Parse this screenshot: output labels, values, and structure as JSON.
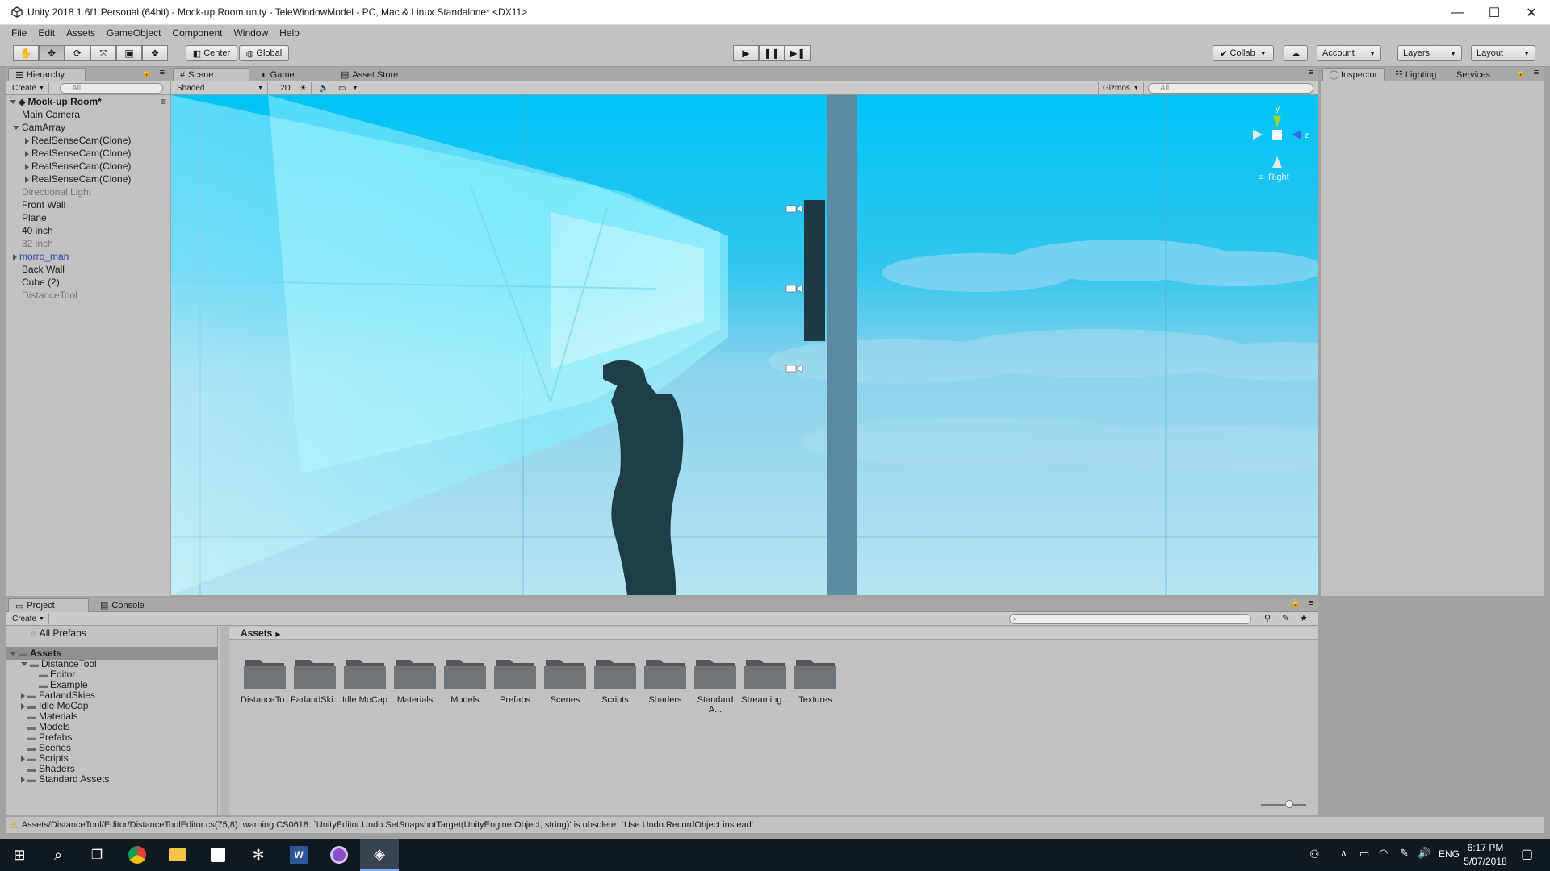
{
  "window": {
    "title": "Unity 2018.1.6f1 Personal (64bit) - Mock-up Room.unity - TeleWindowModel - PC, Mac & Linux Standalone* <DX11>",
    "minimize": "—",
    "maximize": "☐",
    "close": "✕"
  },
  "menu": [
    "File",
    "Edit",
    "Assets",
    "GameObject",
    "Component",
    "Window",
    "Help"
  ],
  "toolbar": {
    "center_label": "Center",
    "global_label": "Global",
    "collab_label": "Collab",
    "account_label": "Account",
    "layers_label": "Layers",
    "layout_label": "Layout"
  },
  "hierarchy": {
    "tab": "Hierarchy",
    "create": "Create",
    "search_placeholder": "All",
    "scene_name": "Mock-up Room*",
    "items": [
      {
        "label": "Main Camera",
        "indent": 1,
        "arrow": "none",
        "style": "normal"
      },
      {
        "label": "CamArray",
        "indent": 1,
        "arrow": "down",
        "style": "normal"
      },
      {
        "label": "RealSenseCam(Clone)",
        "indent": 2,
        "arrow": "right",
        "style": "normal"
      },
      {
        "label": "RealSenseCam(Clone)",
        "indent": 2,
        "arrow": "right",
        "style": "normal"
      },
      {
        "label": "RealSenseCam(Clone)",
        "indent": 2,
        "arrow": "right",
        "style": "normal"
      },
      {
        "label": "RealSenseCam(Clone)",
        "indent": 2,
        "arrow": "right",
        "style": "normal"
      },
      {
        "label": "Directional Light",
        "indent": 1,
        "arrow": "none",
        "style": "disabled"
      },
      {
        "label": "Front Wall",
        "indent": 1,
        "arrow": "none",
        "style": "normal"
      },
      {
        "label": "Plane",
        "indent": 1,
        "arrow": "none",
        "style": "normal"
      },
      {
        "label": "40 inch",
        "indent": 1,
        "arrow": "none",
        "style": "normal"
      },
      {
        "label": "32 inch",
        "indent": 1,
        "arrow": "none",
        "style": "disabled"
      },
      {
        "label": "morro_man",
        "indent": 1,
        "arrow": "right",
        "style": "prefab"
      },
      {
        "label": "Back Wall",
        "indent": 1,
        "arrow": "none",
        "style": "normal"
      },
      {
        "label": "Cube (2)",
        "indent": 1,
        "arrow": "none",
        "style": "normal"
      },
      {
        "label": "DistanceTool",
        "indent": 1,
        "arrow": "none",
        "style": "disabled"
      }
    ]
  },
  "scene": {
    "tabs": [
      "Scene",
      "Game",
      "Asset Store"
    ],
    "shading": "Shaded",
    "mode_2d": "2D",
    "gizmos": "Gizmos",
    "search_placeholder": "All",
    "view_label": "Right",
    "axis_y": "y",
    "axis_z": "z"
  },
  "inspector": {
    "tabs": [
      "Inspector",
      "Lighting",
      "Services"
    ]
  },
  "project": {
    "tabs": [
      "Project",
      "Console"
    ],
    "create": "Create",
    "favorites": "All Prefabs",
    "breadcrumb": "Assets",
    "tree": [
      {
        "label": "Assets",
        "indent": 0,
        "arrow": "down",
        "selected": true
      },
      {
        "label": "DistanceTool",
        "indent": 1,
        "arrow": "down"
      },
      {
        "label": "Editor",
        "indent": 2,
        "arrow": "none"
      },
      {
        "label": "Example",
        "indent": 2,
        "arrow": "none"
      },
      {
        "label": "FarlandSkies",
        "indent": 1,
        "arrow": "right"
      },
      {
        "label": "Idle MoCap",
        "indent": 1,
        "arrow": "right"
      },
      {
        "label": "Materials",
        "indent": 1,
        "arrow": "none"
      },
      {
        "label": "Models",
        "indent": 1,
        "arrow": "none"
      },
      {
        "label": "Prefabs",
        "indent": 1,
        "arrow": "none"
      },
      {
        "label": "Scenes",
        "indent": 1,
        "arrow": "none"
      },
      {
        "label": "Scripts",
        "indent": 1,
        "arrow": "right"
      },
      {
        "label": "Shaders",
        "indent": 1,
        "arrow": "none"
      },
      {
        "label": "Standard Assets",
        "indent": 1,
        "arrow": "right"
      }
    ],
    "folders": [
      "DistanceTo...",
      "FarlandSki...",
      "Idle MoCap",
      "Materials",
      "Models",
      "Prefabs",
      "Scenes",
      "Scripts",
      "Shaders",
      "Standard A...",
      "Streaming...",
      "Textures"
    ]
  },
  "status": {
    "warning": "Assets/DistanceTool/Editor/DistanceToolEditor.cs(75,8): warning CS0618: `UnityEditor.Undo.SetSnapshotTarget(UnityEngine.Object, string)' is obsolete: `Use Undo.RecordObject instead'"
  },
  "taskbar": {
    "lang": "ENG",
    "time": "6:17 PM",
    "date": "5/07/2018"
  },
  "colors": {
    "sky": "#00c3f5",
    "editor_bg": "#c2c2c2",
    "prefab_text": "#1f3ea8",
    "disabled_text": "#777777"
  }
}
